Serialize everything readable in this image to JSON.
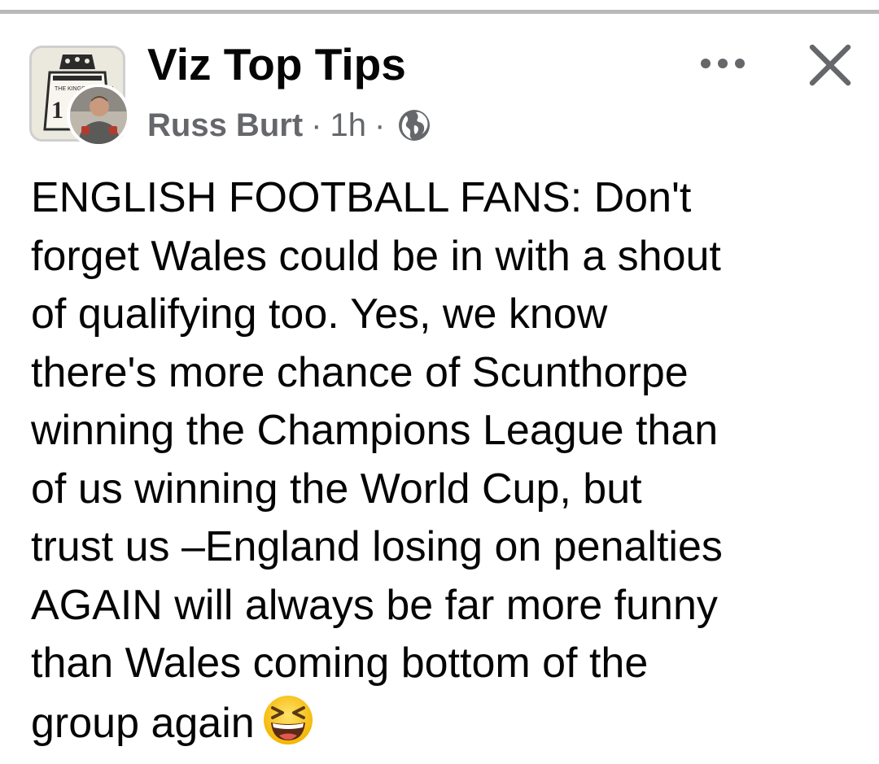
{
  "post": {
    "group_name": "Viz Top Tips",
    "author": "Russ Burt",
    "separator": "·",
    "time": "1h",
    "privacy_icon": "globe-icon",
    "more_icon": "more-horizontal-icon",
    "close_icon": "close-icon",
    "group_avatar_icon": "road-sign-icon",
    "group_avatar_text": "THE KINGS HIGHWAY",
    "text_lines": [
      "ENGLISH FOOTBALL FANS: Don't",
      "forget Wales could be in with a shout",
      "of qualifying too. Yes, we know",
      "there's more chance of Scunthorpe",
      "winning the Champions League than",
      "of us winning the World Cup, but",
      "trust us –England losing on penalties",
      "AGAIN will always be far more funny",
      "than Wales coming bottom of the",
      "group again"
    ],
    "trailing_emoji": "grinning-squinting-face-emoji"
  },
  "colors": {
    "text": "#050505",
    "meta": "#65676b",
    "icon": "#65676b",
    "divider": "#b9b9b9"
  }
}
